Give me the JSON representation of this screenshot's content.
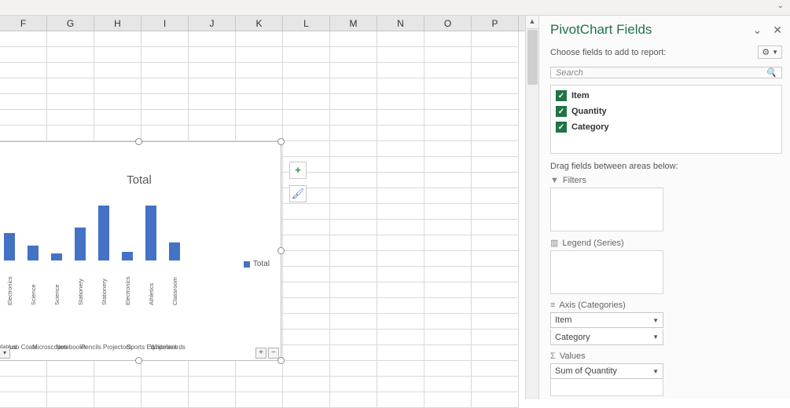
{
  "columns": [
    "F",
    "G",
    "H",
    "I",
    "J",
    "K",
    "L",
    "M",
    "N",
    "O",
    "P"
  ],
  "chart_data": {
    "type": "bar",
    "title": "Total",
    "series_name": "Total",
    "items": [
      {
        "name": "Calculators",
        "group": "Electronics",
        "value": 37
      },
      {
        "name": "Lab Coats",
        "group": "Science",
        "value": 20
      },
      {
        "name": "Microscopes",
        "group": "Science",
        "value": 10
      },
      {
        "name": "Notebooks",
        "group": "Stationery",
        "value": 45
      },
      {
        "name": "Pencils",
        "group": "Stationery",
        "value": 75
      },
      {
        "name": "Projectors",
        "group": "Electronics",
        "value": 12
      },
      {
        "name": "Sports Equipment",
        "group": "Athletics",
        "value": 75
      },
      {
        "name": "Whiteboards",
        "group": "Classroom",
        "value": 25
      }
    ],
    "legend": {
      "label": "Total"
    },
    "ylim": [
      0,
      80
    ]
  },
  "pane": {
    "title": "PivotChart Fields",
    "subtitle": "Choose fields to add to report:",
    "search_placeholder": "Search",
    "fields": [
      {
        "label": "Item",
        "checked": true
      },
      {
        "label": "Quantity",
        "checked": true
      },
      {
        "label": "Category",
        "checked": true
      }
    ],
    "drag_text": "Drag fields between areas below:",
    "areas": {
      "filters": {
        "label": "Filters",
        "value": ""
      },
      "legend": {
        "label": "Legend (Series)",
        "value": ""
      },
      "axis": {
        "label": "Axis (Categories)",
        "value": "Item",
        "value2": "Category"
      },
      "values": {
        "label": "Values",
        "value": "Sum of Quantity"
      }
    }
  }
}
